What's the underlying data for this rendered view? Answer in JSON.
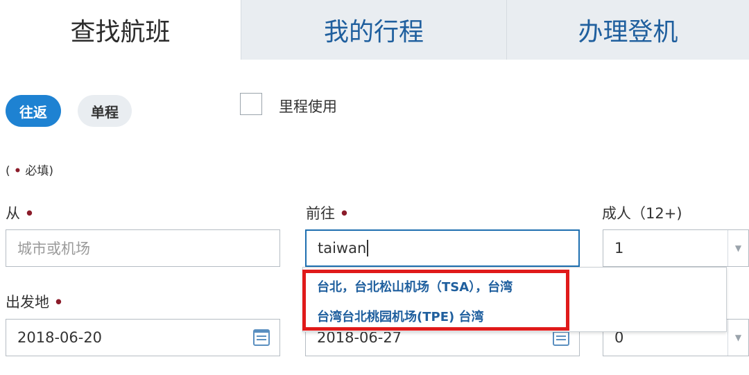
{
  "tabs": [
    {
      "label": "查找航班",
      "active": true
    },
    {
      "label": "我的行程",
      "active": false
    },
    {
      "label": "办理登机",
      "active": false
    }
  ],
  "trip_type": {
    "round_trip": "往返",
    "one_way": "单程",
    "selected": "往返"
  },
  "miles": {
    "label": "里程使用",
    "checked": false
  },
  "required_note": {
    "open": "(",
    "marker": "•",
    "text": "必填)"
  },
  "form": {
    "from": {
      "label": "从",
      "required": true,
      "placeholder": "城市或机场",
      "value": ""
    },
    "to": {
      "label": "前往",
      "required": true,
      "value": "taiwan"
    },
    "adults": {
      "label": "成人（12+)",
      "value": "1"
    },
    "depart": {
      "label": "出发地",
      "required": true,
      "value": "2018-06-20"
    },
    "return": {
      "value": "2018-06-27"
    },
    "children": {
      "value": "0"
    }
  },
  "suggestions": [
    "台北，台北松山机场（TSA），台湾",
    "台湾台北桃园机场(TPE) 台湾"
  ],
  "colors": {
    "accent": "#1e82d2",
    "link": "#1f5f9e",
    "required_dot": "#8b1c2a",
    "highlight": "#e01a1a"
  }
}
